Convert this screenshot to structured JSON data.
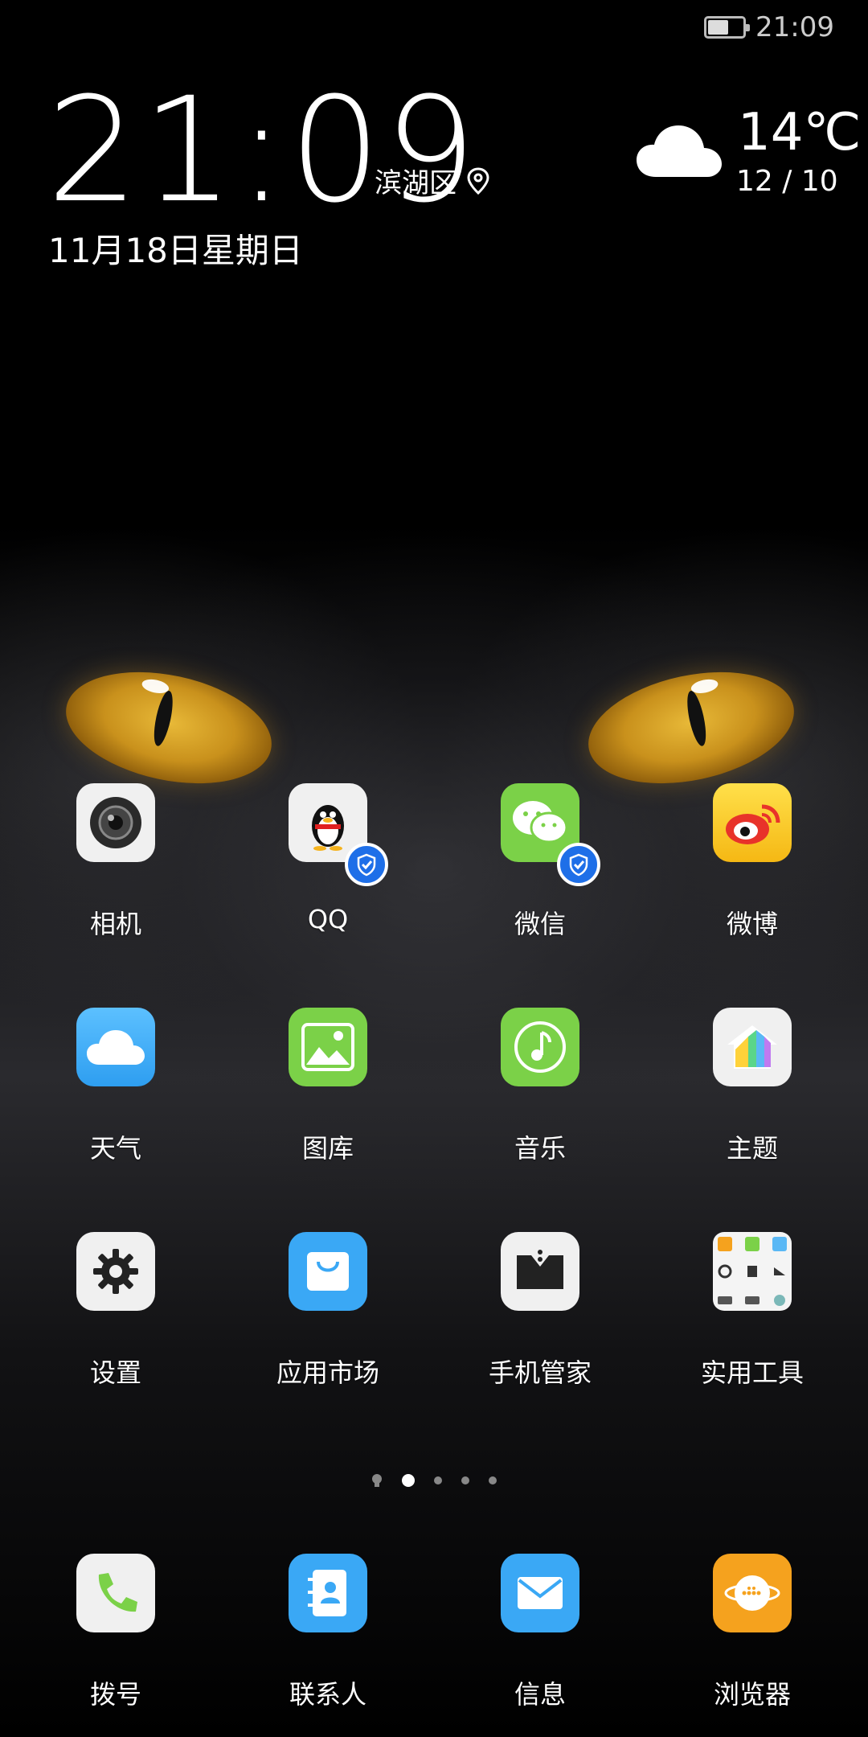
{
  "status_bar": {
    "time": "21:09",
    "battery_level": 0.55
  },
  "clock_widget": {
    "time": "21:09",
    "location": "滨湖区",
    "date": "11月18日星期日",
    "temperature": "14℃",
    "temp_range": "12 / 10"
  },
  "apps": [
    {
      "label": "相机"
    },
    {
      "label": "QQ"
    },
    {
      "label": "微信"
    },
    {
      "label": "微博"
    },
    {
      "label": "天气"
    },
    {
      "label": "图库"
    },
    {
      "label": "音乐"
    },
    {
      "label": "主题"
    },
    {
      "label": "设置"
    },
    {
      "label": "应用市场"
    },
    {
      "label": "手机管家"
    },
    {
      "label": "实用工具"
    }
  ],
  "page_indicator": {
    "pages": 4,
    "current": 1
  },
  "dock": [
    {
      "label": "拨号"
    },
    {
      "label": "联系人"
    },
    {
      "label": "信息"
    },
    {
      "label": "浏览器"
    }
  ],
  "colors": {
    "background": "#000000",
    "verified_badge": "#1e6fe8",
    "wechat_green": "#7bd148",
    "market_blue": "#3aa8f5",
    "browser_orange": "#f5a21e"
  }
}
